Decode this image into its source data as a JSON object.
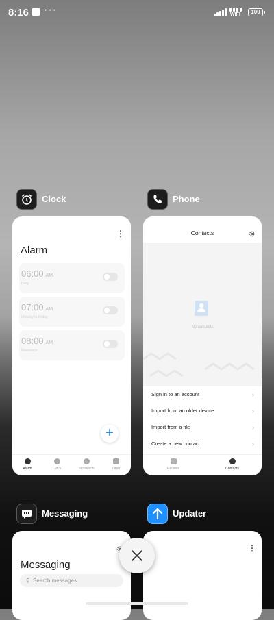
{
  "status_bar": {
    "time": "8:16",
    "overflow": "···",
    "network_label": "WIFI",
    "battery": "100"
  },
  "cards": {
    "clock": {
      "app_name": "Clock",
      "menu": "⋮",
      "title": "Alarm",
      "alarms": [
        {
          "time": "06:00",
          "ampm": "AM",
          "sub": "Daily"
        },
        {
          "time": "07:00",
          "ampm": "AM",
          "sub": "Monday to Friday"
        },
        {
          "time": "08:00",
          "ampm": "AM",
          "sub": "Weekends"
        }
      ],
      "fab": "+",
      "tabs": [
        "Alarm",
        "Clock",
        "Stopwatch",
        "Timer"
      ]
    },
    "phone": {
      "app_name": "Phone",
      "title": "Contacts",
      "empty_text": "No contacts",
      "options": [
        "Sign in to an account",
        "Import from an older device",
        "Import from a file",
        "Create a new contact"
      ],
      "tabs": [
        "Recents",
        "Contacts"
      ]
    },
    "messaging": {
      "app_name": "Messaging",
      "title": "Messaging",
      "search_placeholder": "Search messages"
    },
    "updater": {
      "app_name": "Updater",
      "menu": "⋮"
    }
  },
  "colors": {
    "accent_blue": "#2d86e6",
    "updater_icon": "#1e90ff"
  }
}
